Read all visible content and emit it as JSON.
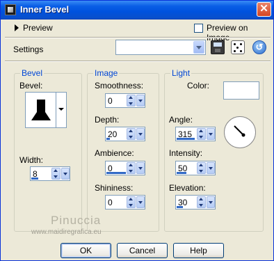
{
  "window": {
    "title": "Inner Bevel",
    "close_glyph": "✕"
  },
  "preview": {
    "label": "Preview",
    "preview_on_image_label": "Preview on Image",
    "preview_on_image_checked": false
  },
  "settings": {
    "label": "Settings",
    "value": ""
  },
  "bevel": {
    "group_title": "Bevel",
    "bevel_label": "Bevel:",
    "width_label": "Width:",
    "width_value": "8"
  },
  "image": {
    "group_title": "Image",
    "smoothness_label": "Smoothness:",
    "smoothness_value": "0",
    "depth_label": "Depth:",
    "depth_value": "20",
    "ambience_label": "Ambience:",
    "ambience_value": "0",
    "shininess_label": "Shininess:",
    "shininess_value": "0"
  },
  "light": {
    "group_title": "Light",
    "color_label": "Color:",
    "color_value": "#FFFFFF",
    "angle_label": "Angle:",
    "angle_value": "315",
    "intensity_label": "Intensity:",
    "intensity_value": "50",
    "elevation_label": "Elevation:",
    "elevation_value": "30"
  },
  "watermark": {
    "name": "Pinuccia",
    "url": "www.maidiregrafica.eu"
  },
  "buttons": {
    "ok": "OK",
    "cancel": "Cancel",
    "help": "Help"
  },
  "icons": [
    "app-icon",
    "close-icon",
    "expand-triangle-icon",
    "dropdown-arrow-icon",
    "save-icon",
    "randomize-dice-icon",
    "reset-icon",
    "spin-arrows-icon"
  ],
  "colors": {
    "titlebar": "#0A5EE6",
    "dialog_bg": "#ECE9D8",
    "group_title": "#0046D5",
    "slider_bar": "#3169C6"
  }
}
